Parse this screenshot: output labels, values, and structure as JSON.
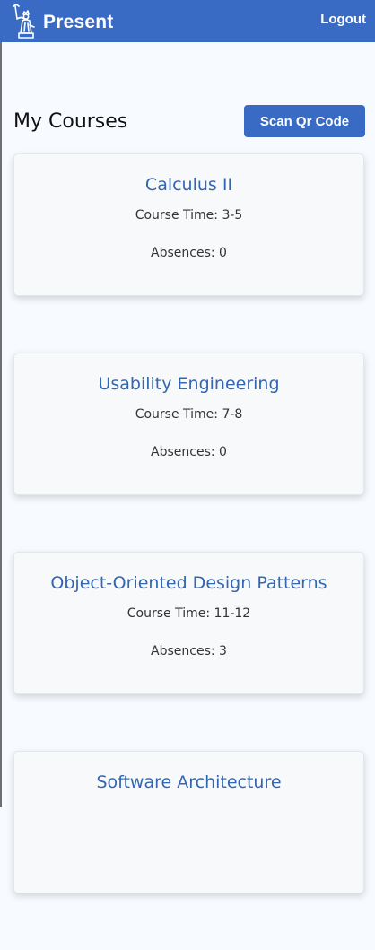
{
  "app": {
    "name": "Present",
    "logout_label": "Logout",
    "brand_color": "#3a6bc4",
    "logo_icon": "statue-of-liberty-logo"
  },
  "page": {
    "title": "My Courses",
    "scan_button_label": "Scan Qr Code"
  },
  "courses": [
    {
      "name": "Calculus II",
      "time": "Course Time: 3-5",
      "absences": "Absences: 0"
    },
    {
      "name": "Usability Engineering",
      "time": "Course Time: 7-8",
      "absences": "Absences: 0"
    },
    {
      "name": "Object-Oriented Design Patterns",
      "time": "Course Time: 11-12",
      "absences": "Absences: 3"
    },
    {
      "name": "Software Architecture",
      "time": "",
      "absences": ""
    }
  ]
}
